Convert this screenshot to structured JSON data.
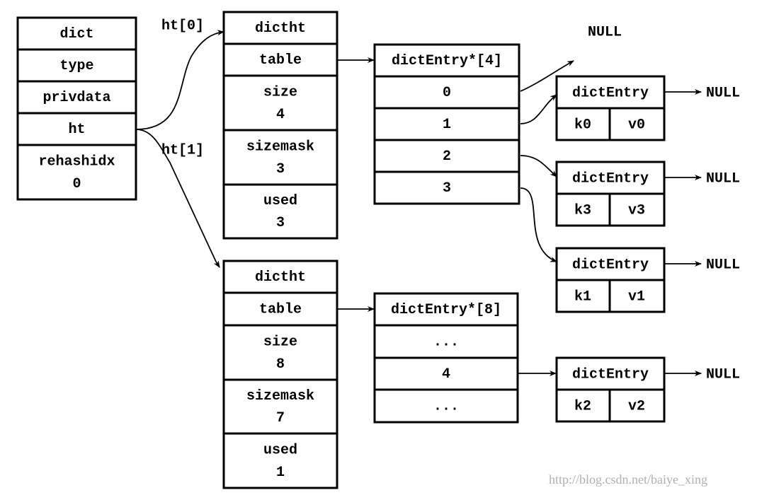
{
  "dict": {
    "rows": [
      [
        "dict"
      ],
      [
        "type"
      ],
      [
        "privdata"
      ],
      [
        "ht"
      ],
      [
        "rehashidx",
        "0"
      ]
    ]
  },
  "ht_labels": [
    "ht[0]",
    "ht[1]"
  ],
  "dictht0": {
    "rows": [
      [
        "dictht"
      ],
      [
        "table"
      ],
      [
        "size",
        "4"
      ],
      [
        "sizemask",
        "3"
      ],
      [
        "used",
        "3"
      ]
    ]
  },
  "dictht1": {
    "rows": [
      [
        "dictht"
      ],
      [
        "table"
      ],
      [
        "size",
        "8"
      ],
      [
        "sizemask",
        "7"
      ],
      [
        "used",
        "1"
      ]
    ]
  },
  "table4": {
    "rows": [
      [
        "dictEntry*[4]"
      ],
      [
        "0"
      ],
      [
        "1"
      ],
      [
        "2"
      ],
      [
        "3"
      ]
    ]
  },
  "table8": {
    "rows": [
      [
        "dictEntry*[8]"
      ],
      [
        "..."
      ],
      [
        "4"
      ],
      [
        "..."
      ]
    ]
  },
  "entries": [
    {
      "title": "dictEntry",
      "key": "k0",
      "value": "v0",
      "next": "NULL"
    },
    {
      "title": "dictEntry",
      "key": "k3",
      "value": "v3",
      "next": "NULL"
    },
    {
      "title": "dictEntry",
      "key": "k1",
      "value": "v1",
      "next": "NULL"
    },
    {
      "title": "dictEntry",
      "key": "k2",
      "value": "v2",
      "next": "NULL"
    }
  ],
  "null_label": "NULL",
  "watermark": "http://blog.csdn.net/baiye_xing"
}
